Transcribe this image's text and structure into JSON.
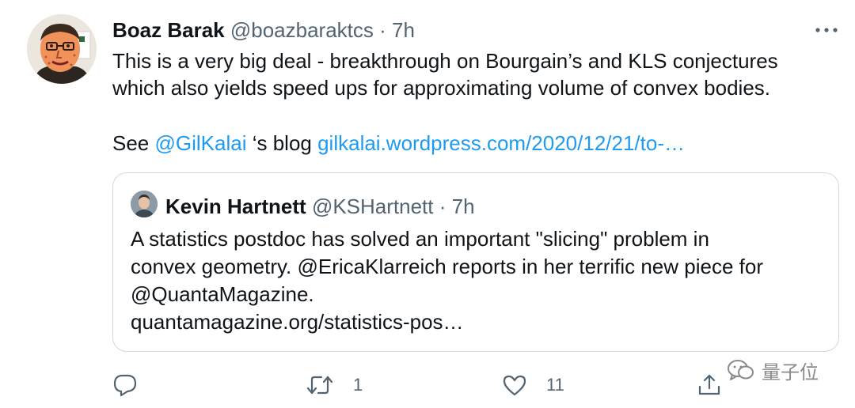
{
  "tweet": {
    "author_name": "Boaz Barak",
    "author_handle": "@boazbaraktcs",
    "separator": "·",
    "time": "7h",
    "text_line1": "This is a very big deal - breakthrough on Bourgain’s and KLS conjectures",
    "text_line2": "which also yields speed ups for approximating volume of convex bodies.",
    "see_prefix": "See ",
    "mention": "@GilKalai",
    "blog_text": " ‘s blog ",
    "link": "gilkalai.wordpress.com/2020/12/21/to-…"
  },
  "quote": {
    "author_name": "Kevin Hartnett",
    "author_handle": "@KSHartnett",
    "separator": "·",
    "time": "7h",
    "line1": "A statistics postdoc has solved an important \"slicing\" problem in",
    "line2": "convex geometry. @EricaKlarreich reports in her terrific new piece for",
    "line3": "@QuantaMagazine.",
    "line4": "quantamagazine.org/statistics-pos…"
  },
  "actions": {
    "reply_icon": "reply-icon",
    "retweet_icon": "retweet-icon",
    "retweet_count": "1",
    "like_icon": "heart-icon",
    "like_count": "11",
    "share_icon": "share-icon"
  },
  "watermark": {
    "text": "量子位"
  },
  "colors": {
    "link": "#1d9bf0",
    "secondary_text": "#536471",
    "border": "#cfd9de"
  }
}
